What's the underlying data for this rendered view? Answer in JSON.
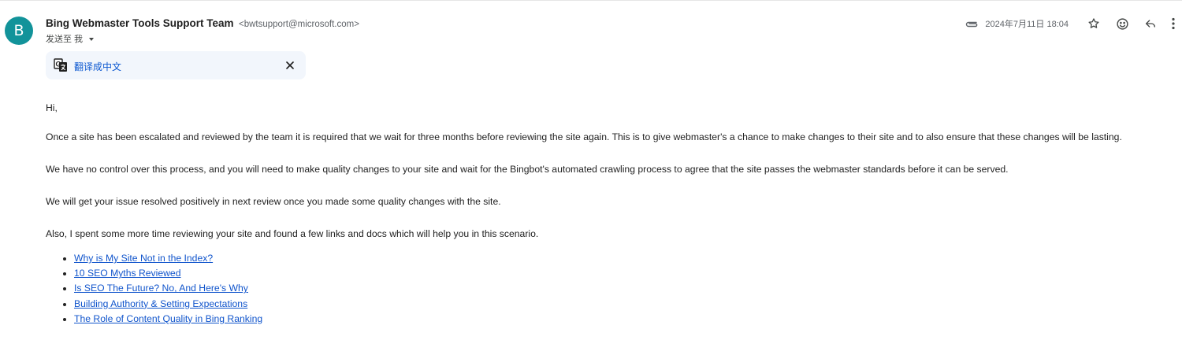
{
  "header": {
    "avatar_letter": "B",
    "avatar_color": "#12939a",
    "sender_name": "Bing Webmaster Tools Support Team",
    "sender_email": "<bwtsupport@microsoft.com>",
    "recipient_label": "发送至 我",
    "date": "2024年7月11日 18:04",
    "icons": [
      "attachment-icon",
      "star-icon",
      "emoji-icon",
      "reply-icon",
      "more-vert-icon"
    ]
  },
  "translate_bar": {
    "label": "翻译成中文",
    "icon": "translate-icon",
    "close_icon": "close-icon"
  },
  "body": {
    "greeting": "Hi,",
    "paragraphs": [
      "Once a site has been escalated and reviewed by the team it is required that we wait for three months before reviewing the site again. This is to give webmaster's a chance to make changes to their site and to also ensure that these changes will be lasting.",
      "We have no control over this process, and you will need to make quality changes to your site and wait for the Bingbot's automated crawling process to agree that the site passes the webmaster standards before it can be served.",
      "We will get your issue resolved positively in next review once you made some quality changes with the site.",
      "Also, I spent some more time reviewing your site and found a few links and docs which will help you in this scenario."
    ],
    "links": [
      "Why is My Site Not in the Index?",
      "10 SEO Myths Reviewed",
      "Is SEO The Future? No, And Here's Why",
      "Building Authority & Setting Expectations",
      "The Role of Content Quality in Bing Ranking"
    ]
  },
  "colors": {
    "link": "#1155cc",
    "translate_bg": "#f2f6fc",
    "translate_text": "#0b57d0"
  }
}
